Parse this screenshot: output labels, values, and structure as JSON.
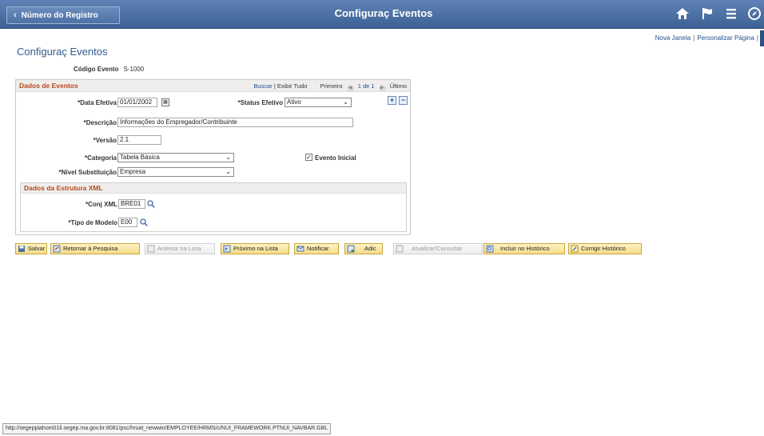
{
  "header": {
    "back_label": "Número do Registro",
    "title": "Configuraç Eventos",
    "icons": [
      "home-icon",
      "flag-icon",
      "menu-icon",
      "navbar-icon"
    ]
  },
  "top_links": {
    "new_window": "Nova Janela",
    "personalize": "Personalizar Página"
  },
  "page": {
    "title": "Configuraç Eventos",
    "code_label": "Código Evento",
    "code_value": "S-1000"
  },
  "group": {
    "title": "Dados de Eventos",
    "find": "Buscar",
    "view_all": "Exibir Tudo",
    "first": "Primeiro",
    "count": "1 de 1",
    "last": "Último"
  },
  "fields": {
    "effdt_label": "*Data Efetiva",
    "effdt_value": "01/01/2002",
    "status_label": "*Status Efetivo",
    "status_value": "Ativo",
    "descr_label": "*Descrição",
    "descr_value": "Informações do Empregador/Contribuinte",
    "version_label": "*Versão",
    "version_value": "2.1",
    "category_label": "*Categoria",
    "category_value": "Tabela Básica",
    "initial_event_label": "Evento Inicial",
    "initial_event_checked": true,
    "level_label": "*Nível Substituição",
    "level_value": "Empresa"
  },
  "xml": {
    "title": "Dados da Estrutura XML",
    "conj_label": "*Conj XML",
    "conj_value": "BRE01",
    "model_label": "*Tipo de Modelo",
    "model_value": "E00"
  },
  "toolbar": {
    "save": "Salvar",
    "return": "Retornar à Pesquisa",
    "prev": "Anterior na Lista",
    "next": "Próximo na Lista",
    "notify": "Notificar",
    "add": "Adic",
    "update": "Atualizar/Consultar",
    "include_hist": "Incluir no Histórico",
    "correct_hist": "Corrigir Histórico"
  },
  "status_bar": {
    "url": "http://segeppiahom01li.segep.ma.gov.br:8081/psc/hruat_newwin/EMPLOYEE/HRMS/c/NUI_FRAMEWORK.PTNUI_NAVBAR.GBL"
  }
}
